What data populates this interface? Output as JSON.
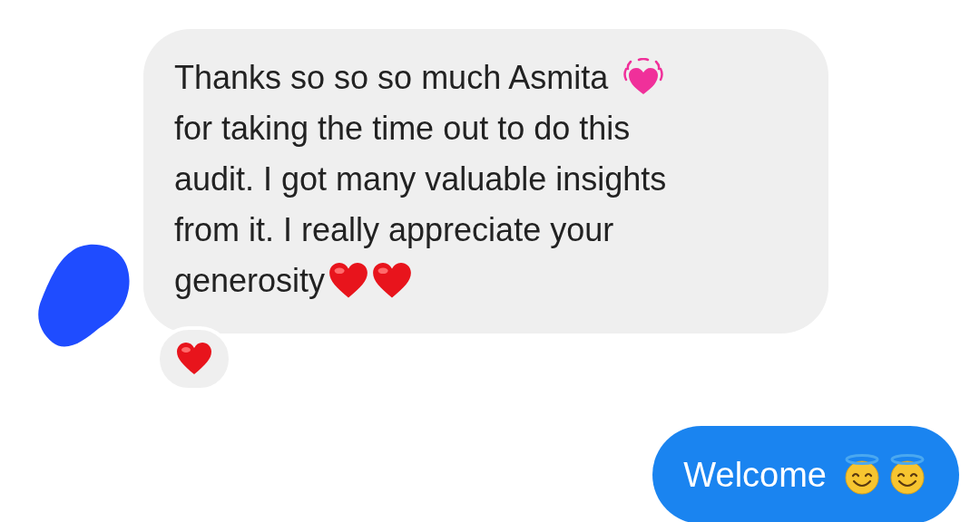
{
  "messages": [
    {
      "kind": "received",
      "lines": [
        {
          "parts": [
            {
              "kind": "text",
              "text": "Thanks so so so much Asmita"
            },
            {
              "kind": "beating-heart"
            }
          ]
        },
        {
          "parts": [
            {
              "kind": "text",
              "text": "for taking the time out to do this"
            }
          ]
        },
        {
          "parts": [
            {
              "kind": "text",
              "text": "audit. I got many valuable insights"
            }
          ]
        },
        {
          "parts": [
            {
              "kind": "text",
              "text": "from it. I really appreciate your"
            }
          ]
        },
        {
          "parts": [
            {
              "kind": "text",
              "text": "generosity"
            },
            {
              "kind": "heart"
            },
            {
              "kind": "heart"
            }
          ]
        }
      ],
      "reactions": [
        {
          "kind": "heart"
        }
      ]
    },
    {
      "kind": "sent",
      "lines": [
        {
          "parts": [
            {
              "kind": "text",
              "text": "Welcome"
            },
            {
              "kind": "halo-face"
            },
            {
              "kind": "halo-face"
            }
          ]
        }
      ]
    }
  ]
}
